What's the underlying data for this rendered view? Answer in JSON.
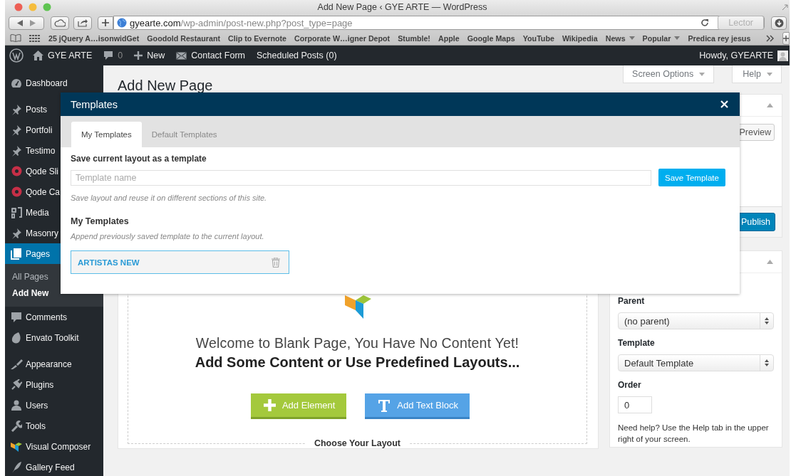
{
  "browser": {
    "title": "Add New Page ‹ GYE ARTE — WordPress",
    "address": {
      "host": "gyearte.com",
      "path": "/wp-admin/post-new.php?post_type=page"
    },
    "reader_button": {
      "label": "Lector",
      "disabled": true
    },
    "bookmarks": [
      {
        "label": "25 jQuery A…isonwidGet",
        "kind": "link"
      },
      {
        "label": "Goodold Restaurant",
        "kind": "link"
      },
      {
        "label": "Clip to Evernote",
        "kind": "link"
      },
      {
        "label": "Corporate W…igner Depot",
        "kind": "link"
      },
      {
        "label": "Stumble!",
        "kind": "link"
      },
      {
        "label": "Apple",
        "kind": "link"
      },
      {
        "label": "Google Maps",
        "kind": "link"
      },
      {
        "label": "YouTube",
        "kind": "link"
      },
      {
        "label": "Wikipedia",
        "kind": "link"
      },
      {
        "label": "News",
        "kind": "menu"
      },
      {
        "label": "Popular",
        "kind": "menu"
      },
      {
        "label": "Predica rey jesus",
        "kind": "link"
      }
    ]
  },
  "admin_bar": {
    "site": "GYE ARTE",
    "comment_count": "0",
    "new": "New",
    "contact_form": "Contact Form",
    "scheduled": "Scheduled Posts (0)",
    "greeting": "Howdy, GYEARTE"
  },
  "sidebar": {
    "groups": [
      {
        "items": [
          {
            "label": "Dashboard",
            "kind": "dashboard",
            "selected": false
          }
        ]
      },
      {
        "items": [
          {
            "label": "Posts",
            "kind": "pin",
            "selected": false
          },
          {
            "label": "Portfoli",
            "kind": "pin",
            "selected": false
          },
          {
            "label": "Testimo",
            "kind": "pin",
            "selected": false
          },
          {
            "label": "Qode Sli",
            "kind": "ring",
            "selected": false
          },
          {
            "label": "Qode Ca",
            "kind": "ring",
            "selected": false
          },
          {
            "label": "Media",
            "kind": "media",
            "selected": false
          },
          {
            "label": "Masonry",
            "kind": "pin",
            "selected": false
          },
          {
            "label": "Pages",
            "kind": "pages",
            "selected": true,
            "children": [
              {
                "label": "All Pages",
                "selected": false
              },
              {
                "label": "Add New",
                "selected": true
              }
            ]
          },
          {
            "label": "Comments",
            "kind": "comment",
            "selected": false
          },
          {
            "label": "Envato Toolkit",
            "kind": "leaf",
            "selected": false
          }
        ]
      },
      {
        "items": [
          {
            "label": "Appearance",
            "kind": "brush",
            "selected": false
          },
          {
            "label": "Plugins",
            "kind": "plug",
            "selected": false
          },
          {
            "label": "Users",
            "kind": "user",
            "selected": false
          },
          {
            "label": "Tools",
            "kind": "wrench",
            "selected": false
          },
          {
            "label": "Visual Composer",
            "kind": "vc",
            "selected": false
          },
          {
            "label": "Gallery Feed",
            "kind": "feather",
            "selected": false
          }
        ]
      }
    ]
  },
  "page": {
    "heading": "Add New Page",
    "screen_options": "Screen Options",
    "help": "Help"
  },
  "editor": {
    "welcome": "Welcome to Blank Page, You Have No Content Yet!",
    "prompt": "Add Some Content or Use Predefined Layouts...",
    "buttons": [
      {
        "label": "Add Element",
        "kind": "element"
      },
      {
        "label": "Add Text Block",
        "kind": "text"
      }
    ],
    "layout_heading": "Choose Your Layout"
  },
  "publish_box": {
    "preview": "Preview",
    "publish": "Publish"
  },
  "attributes_box": {
    "parent_label": "Parent",
    "parent_value": "(no parent)",
    "template_label": "Template",
    "template_value": "Default Template",
    "order_label": "Order",
    "order_value": "0",
    "help_text": "Need help? Use the Help tab in the upper right of your screen."
  },
  "modal": {
    "title": "Templates",
    "tabs": [
      {
        "label": "My Templates",
        "selected": true
      },
      {
        "label": "Default Templates",
        "selected": false
      }
    ],
    "save_heading": "Save current layout as a template",
    "name_placeholder": "Template name",
    "save_button": "Save Template",
    "save_hint": "Save layout and reuse it on different sections of this site.",
    "list_heading": "My Templates",
    "list_hint": "Append previously saved template to the current layout.",
    "templates": [
      {
        "name": "ARTISTAS NEW"
      }
    ]
  }
}
